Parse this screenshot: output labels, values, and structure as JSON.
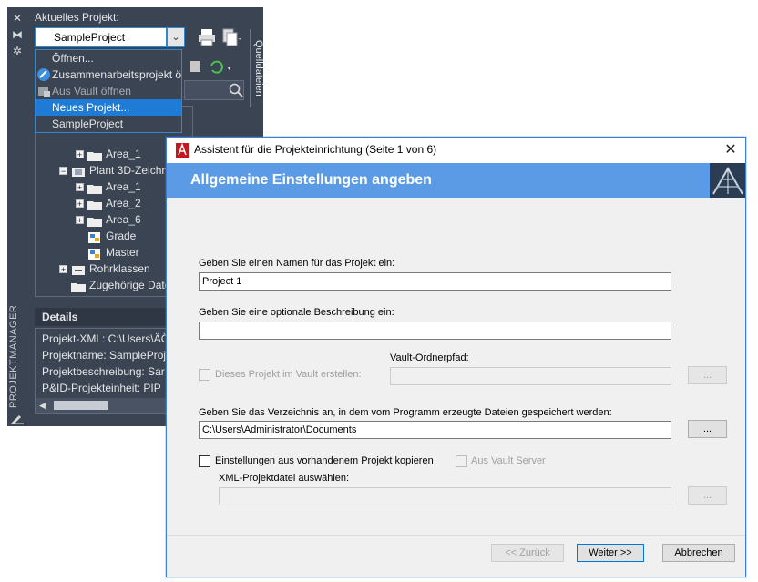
{
  "project_manager": {
    "current_project_label": "Aktuelles Projekt:",
    "current_project_value": "SampleProject",
    "side_label": "PROJEKTMANAGER",
    "quell_tab": "Quelldateien",
    "dropdown_items": [
      {
        "label": "Öffnen..."
      },
      {
        "label": "Zusammenarbeitsprojekt ö"
      },
      {
        "label": "Aus Vault öffnen"
      },
      {
        "label": "Neues Projekt..."
      },
      {
        "label": "SampleProject"
      }
    ],
    "tree": [
      {
        "label": "Area_1"
      },
      {
        "label": "Plant 3D-Zeichn"
      },
      {
        "label": "Area_1"
      },
      {
        "label": "Area_2"
      },
      {
        "label": "Area_6"
      },
      {
        "label": "Grade"
      },
      {
        "label": "Master"
      },
      {
        "label": "Rohrklassen"
      },
      {
        "label": "Zugehörige Date"
      }
    ],
    "details": {
      "title": "Details",
      "rows": [
        {
          "text": "Projekt-XML:  C:\\Users\\ÄÖ"
        },
        {
          "text": "Projektname:  SampleProj"
        },
        {
          "text": "Projektbeschreibung:  Sar"
        },
        {
          "text": "P&ID-Projekteinheit:  PIP"
        }
      ]
    }
  },
  "wizard": {
    "title": "Assistent für die Projekteinrichtung (Seite 1 von 6)",
    "close_glyph": "✕",
    "heading": "Allgemeine Einstellungen angeben",
    "name_label": "Geben Sie einen Namen für das Projekt ein:",
    "name_value": "Project 1",
    "desc_label": "Geben Sie eine optionale Beschreibung ein:",
    "desc_value": "",
    "vault_checkbox_label": "Dieses Projekt im Vault erstellen:",
    "vault_path_label": "Vault-Ordnerpfad:",
    "vault_path_value": "",
    "browse_label": "...",
    "dir_label": "Geben Sie das Verzeichnis an, in dem vom Programm erzeugte Dateien gespeichert werden:",
    "dir_value": "C:\\Users\\Administrator\\Documents",
    "copy_checkbox_label": "Einstellungen aus vorhandenem Projekt kopieren",
    "vault_server_label": "Aus Vault Server",
    "xml_label": "XML-Projektdatei auswählen:",
    "xml_value": "",
    "back_button": "<< Zurück",
    "next_button": "Weiter >>",
    "cancel_button": "Abbrechen"
  }
}
